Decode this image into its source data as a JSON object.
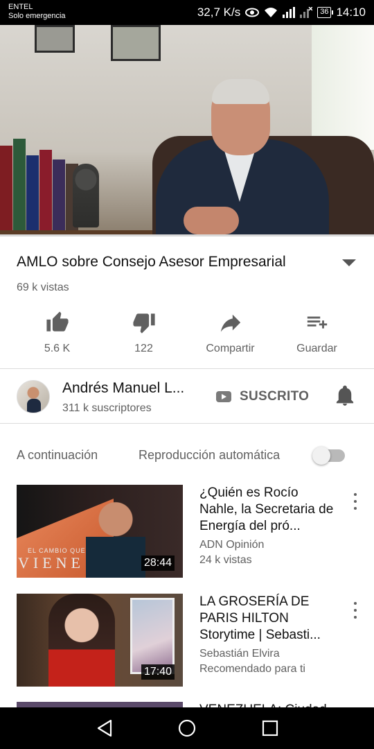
{
  "status_bar": {
    "carrier": "ENTEL",
    "network_note": "Solo emergencia",
    "speed": "32,7 K/s",
    "battery": "36",
    "time": "14:10"
  },
  "video": {
    "title": "AMLO sobre Consejo Asesor Empresarial",
    "views": "69 k vistas",
    "progress_fraction": 0.0
  },
  "actions": [
    {
      "label": "5.6 K",
      "icon": "thumbs-up-icon"
    },
    {
      "label": "122",
      "icon": "thumbs-down-icon"
    },
    {
      "label": "Compartir",
      "icon": "share-icon"
    },
    {
      "label": "Guardar",
      "icon": "add-to-playlist-icon"
    }
  ],
  "channel": {
    "name": "Andrés Manuel L...",
    "subscribers": "311 k suscriptores",
    "subscribe_label": "SUSCRITO"
  },
  "up_next": {
    "label": "A continuación",
    "autoplay_label": "Reproducción automática",
    "autoplay_on": false
  },
  "recommendations": [
    {
      "title": "¿Quién es Rocío Nahle, la Secretaria de Energía del pró...",
      "channel": "ADN Opinión",
      "meta": "24 k vistas",
      "duration": "28:44",
      "thumb_caption_small": "EL CAMBIO QUE",
      "thumb_caption_big": "VIENE"
    },
    {
      "title": "LA GROSERÍA DE PARIS HILTON Storytime | Sebasti...",
      "channel": "Sebastián Elvira",
      "meta": "Recomendado para ti",
      "duration": "17:40"
    },
    {
      "title": "VENEZUELA: Ciudad"
    }
  ],
  "colors": {
    "accent_text": "#606060",
    "primary_text": "#111111",
    "status_bar_bg": "#000000"
  }
}
